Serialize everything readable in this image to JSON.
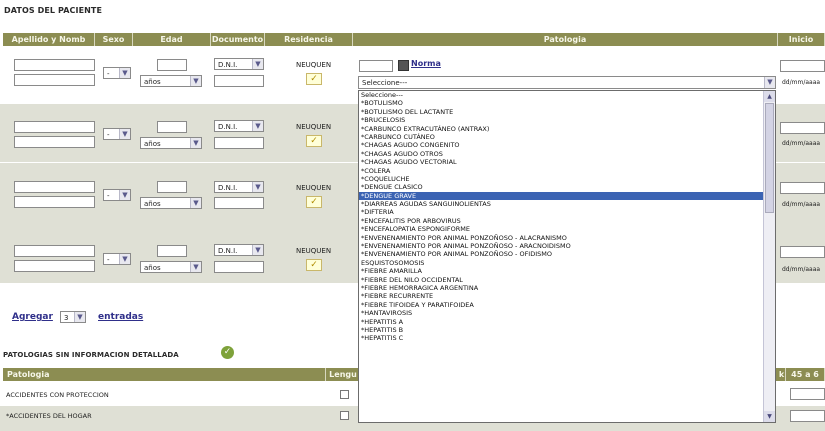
{
  "patient_section": {
    "title": "DATOS DEL PACIENTE"
  },
  "columns": {
    "apellido": "Apellido y Nomb",
    "sexo": "Sexo",
    "edad": "Edad",
    "documento": "Documento",
    "residencia": "Residencia",
    "patologia": "Patologia",
    "inicio": "Inicio"
  },
  "rows": [
    {
      "sexo": "-",
      "edad_unit": "años",
      "doc_type": "D.N.I.",
      "residencia": "NEUQUEN",
      "fecha_hint": "dd/mm/aaaa"
    },
    {
      "sexo": "-",
      "edad_unit": "años",
      "doc_type": "D.N.I.",
      "residencia": "NEUQUEN",
      "fecha_hint": "dd/mm/aaaa"
    },
    {
      "sexo": "-",
      "edad_unit": "años",
      "doc_type": "D.N.I.",
      "residencia": "NEUQUEN",
      "fecha_hint": "dd/mm/aaaa"
    },
    {
      "sexo": "-",
      "edad_unit": "años",
      "doc_type": "D.N.I.",
      "residencia": "NEUQUEN",
      "fecha_hint": "dd/mm/aaaa"
    }
  ],
  "pathology": {
    "norma_label": "Norma",
    "select_value": "Seleccione---"
  },
  "dropdown": {
    "items": [
      "Seleccione---",
      "*BOTULISMO",
      "*BOTULISMO DEL LACTANTE",
      "*BRUCELOSIS",
      "*CARBUNCO EXTRACUTÁNEO (ANTRAX)",
      "*CARBUNCO CUTÁNEO",
      "*CHAGAS AGUDO CONGENITO",
      "*CHAGAS AGUDO OTROS",
      "*CHAGAS AGUDO VECTORIAL",
      "*COLERA",
      "*COQUELUCHE",
      "*DENGUE CLASICO",
      "*DENGUE GRAVE",
      "*DIARREAS AGUDAS SANGUINOLIENTAS",
      "*DIFTERIA",
      "*ENCEFALITIS POR ARBOVIRUS",
      "*ENCEFALOPATIA ESPONGIFORME",
      "*ENVENENAMIENTO POR ANIMAL PONZOÑOSO - ALACRANISMO",
      "*ENVENENAMIENTO POR ANIMAL PONZOÑOSO - ARACNOIDISMO",
      "*ENVENENAMIENTO POR ANIMAL PONZOÑOSO - OFIDISMO",
      "ESQUISTOSOMOSIS",
      "*FIEBRE AMARILLA",
      "*FIEBRE DEL NILO OCCIDENTAL",
      "*FIEBRE HEMORRAGICA ARGENTINA",
      "*FIEBRE RECURRENTE",
      "*FIEBRE TIFOIDEA Y PARATIFOIDEA",
      "*HANTAVIROSIS",
      "*HEPATITIS A",
      "*HEPATITIS B",
      "*HEPATITIS C"
    ],
    "highlighted": "*DENGUE GRAVE"
  },
  "agregar": {
    "label": "Agregar",
    "count": "3",
    "suffix": "entradas"
  },
  "no_detail_section": {
    "title": "PATOLOGIAS SIN INFORMACION DETALLADA",
    "col_patologia": "Patologia",
    "col_mid": "Lengu",
    "col_k": "k",
    "col_range": "45 a 6",
    "rows": [
      "ACCIDENTES CON PROTECCION",
      "*ACCIDENTES DEL HOGAR"
    ]
  },
  "icons": {
    "norma": "book-icon",
    "leaf": "leaf-icon",
    "check": "check-icon"
  },
  "colors": {
    "header_olive": "#8c8d52",
    "row_gray": "#dfe0d5",
    "highlight": "#3b63b3"
  }
}
